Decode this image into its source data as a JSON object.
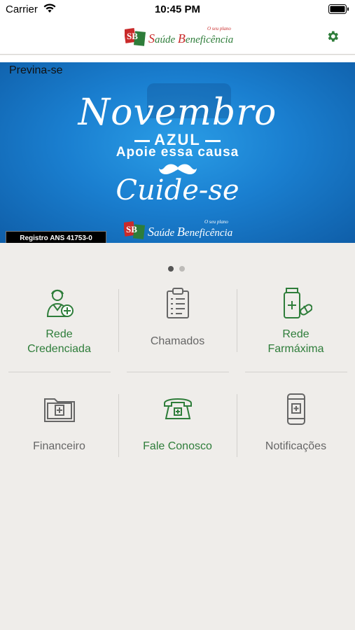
{
  "status_bar": {
    "carrier": "Carrier",
    "time": "10:45 PM"
  },
  "header": {
    "logo": {
      "mark": "SB",
      "text_s": "S",
      "text_aude": "aúde",
      "text_b": "B",
      "text_rest": "eneficência",
      "tagline": "O seu plano"
    },
    "settings_icon": "gear-icon"
  },
  "banner": {
    "section_title": "Previna-se",
    "headline": "Novembro",
    "subheadline": "AZUL",
    "cause": "Apoie essa causa",
    "closing": "Cuide-se",
    "registro": "Registro ANS 41753-0",
    "logo": {
      "text_s": "S",
      "text_aude": "aúde",
      "text_b": "B",
      "text_rest": "eneficência",
      "tagline": "O seu plano"
    }
  },
  "carousel": {
    "page_count": 2,
    "active_index": 0
  },
  "colors": {
    "accent_green": "#2e7d3a",
    "brand_red": "#c92a2a",
    "banner_blue": "#1a7fd0",
    "muted_gray": "#666666"
  },
  "menu": [
    {
      "line1": "Rede",
      "line2": "Credenciada",
      "icon": "doctor-icon",
      "style": "green"
    },
    {
      "line1": "Chamados",
      "line2": "",
      "icon": "clipboard-icon",
      "style": "gray"
    },
    {
      "line1": "Rede",
      "line2": "Farmáxima",
      "icon": "pharmacy-icon",
      "style": "green"
    },
    {
      "line1": "Financeiro",
      "line2": "",
      "icon": "folder-icon",
      "style": "gray"
    },
    {
      "line1": "Fale Conosco",
      "line2": "",
      "icon": "telephone-icon",
      "style": "green"
    },
    {
      "line1": "Notificações",
      "line2": "",
      "icon": "smartphone-icon",
      "style": "gray"
    }
  ]
}
